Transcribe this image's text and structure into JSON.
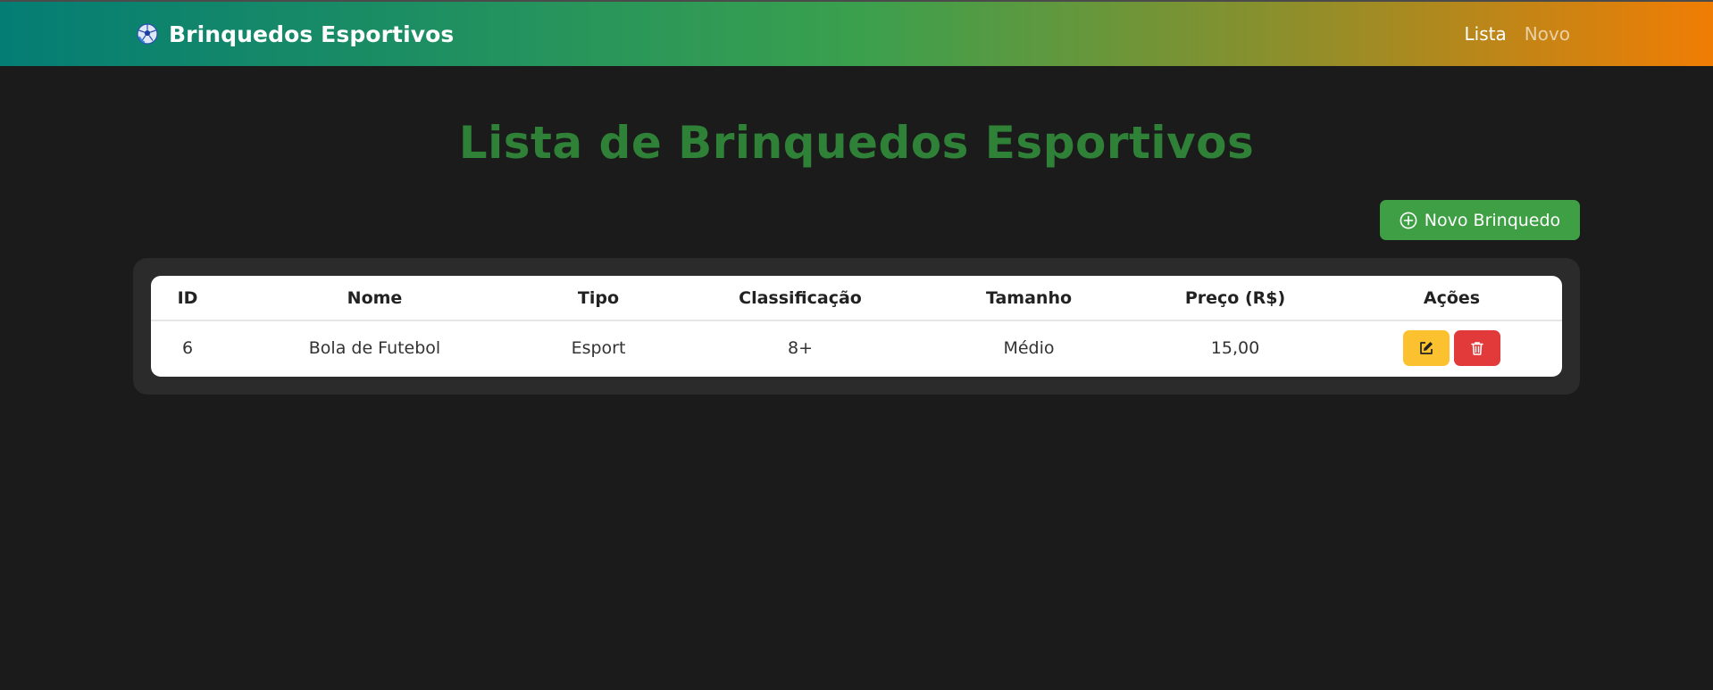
{
  "navbar": {
    "brand": "Brinquedos Esportivos",
    "brand_icon": "soccer-ball-icon",
    "links": [
      {
        "label": "Lista",
        "active": true
      },
      {
        "label": "Novo",
        "active": false
      }
    ]
  },
  "page": {
    "title": "Lista de Brinquedos Esportivos",
    "new_button_label": "Novo Brinquedo",
    "new_button_icon": "plus-circle-icon"
  },
  "table": {
    "headers": [
      "ID",
      "Nome",
      "Tipo",
      "Classificação",
      "Tamanho",
      "Preço (R$)",
      "Ações"
    ],
    "rows": [
      {
        "id": "6",
        "nome": "Bola de Futebol",
        "tipo": "Esport",
        "classificacao": "8+",
        "tamanho": "Médio",
        "preco": "15,00"
      }
    ],
    "row_actions": [
      "edit-icon",
      "trash-icon"
    ]
  },
  "colors": {
    "background": "#1b1b1b",
    "title": "#2e8136",
    "primary_button": "#3f9f45",
    "edit_button": "#fcc12f",
    "delete_button": "#e23a3a",
    "navbar_gradient": [
      "#047d74",
      "#3aa04e",
      "#f07d04"
    ]
  }
}
